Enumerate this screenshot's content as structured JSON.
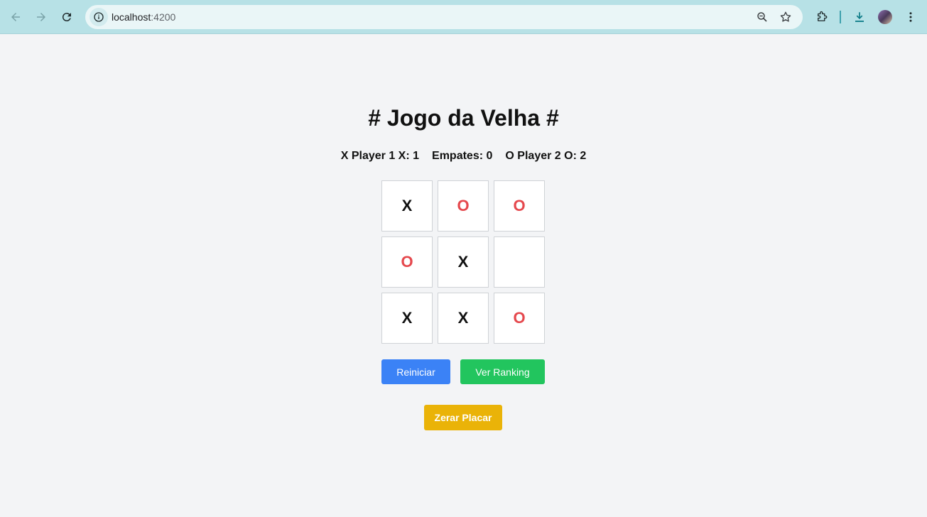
{
  "browser": {
    "url_host": "localhost",
    "url_port": ":4200"
  },
  "page": {
    "title": "# Jogo da Velha #"
  },
  "scoreboard": {
    "player1": "X Player 1 X: 1",
    "draws": "Empates: 0",
    "player2": "O Player 2 O: 2"
  },
  "board": {
    "cells": [
      "X",
      "O",
      "O",
      "O",
      "X",
      "",
      "X",
      "X",
      "O"
    ]
  },
  "buttons": {
    "restart": "Reiniciar",
    "ranking": "Ver Ranking",
    "reset_score": "Zerar Placar"
  },
  "colors": {
    "x_mark": "#111111",
    "o_mark": "#e5484d",
    "restart": "#3b82f6",
    "ranking": "#22c55e",
    "reset": "#eab308"
  }
}
